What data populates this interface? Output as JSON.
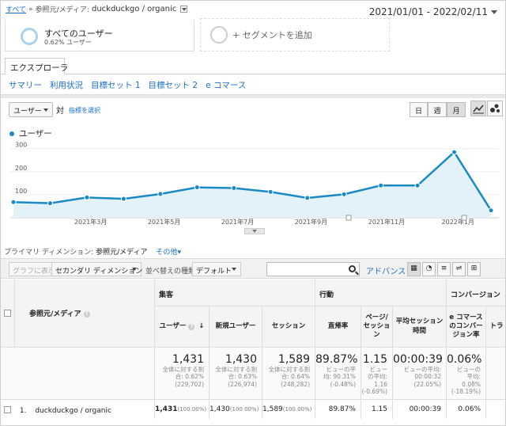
{
  "breadcrumb": {
    "root": "すべて",
    "sep": "»",
    "dim": "参照元/メディア:",
    "current": "duckduckgo / organic"
  },
  "date_range": "2021/01/01 - 2022/02/11",
  "segments": {
    "all_users": {
      "title": "すべてのユーザー",
      "sub": "0.62% ユーザー"
    },
    "add": "+ セグメントを追加"
  },
  "tab": "エクスプローラ",
  "subnav": [
    "サマリー",
    "利用状況",
    "目標セット 1",
    "目標セット 2",
    "e コマース"
  ],
  "metric_select": "ユーザー",
  "vs": "対",
  "pick_metric": "指標を選択",
  "granularity": [
    "日",
    "週",
    "月"
  ],
  "granularity_selected": "月",
  "chart_data": {
    "type": "area",
    "legend": "ユーザー",
    "y_ticks": [
      "100",
      "200",
      "300"
    ],
    "x_tick_labels": [
      "2021年3月",
      "2021年5月",
      "2021年7月",
      "2021年9月",
      "2021年11月",
      "2022年1月"
    ],
    "x": [
      "2021-01",
      "2021-02",
      "2021-03",
      "2021-04",
      "2021-05",
      "2021-06",
      "2021-07",
      "2021-08",
      "2021-09",
      "2021-10",
      "2021-11",
      "2021-12",
      "2022-01",
      "2022-02"
    ],
    "values": [
      68,
      63,
      88,
      82,
      103,
      132,
      129,
      112,
      86,
      102,
      140,
      140,
      285,
      32
    ],
    "ylim": [
      0,
      330
    ],
    "color": "#1a8ac6"
  },
  "dimension_row": {
    "label": "プライマリ ディメンション:",
    "current": "参照元/メディア",
    "other": "その他"
  },
  "toolbar": {
    "plot": "グラフに表示",
    "secondary": "セカンダリ ディメンション",
    "sort_label": "並べ替えの種類:",
    "sort": "デフォルト",
    "advanced": "アドバンス"
  },
  "table": {
    "dim_header": "参照元/メディア",
    "groups": [
      "集客",
      "行動",
      "コンバージョン"
    ],
    "columns": [
      "ユーザー",
      "新規ユーザー",
      "セッション",
      "直帰率",
      "ページ/セッション",
      "平均セッション時間",
      "e コマースのコンバージョン率",
      "トラ"
    ],
    "totals": [
      {
        "big": "1,431",
        "lines": [
          "全体に対する割",
          "合: 0.62%",
          "(229,702)"
        ]
      },
      {
        "big": "1,430",
        "lines": [
          "全体に対する割",
          "合: 0.63%",
          "(226,974)"
        ]
      },
      {
        "big": "1,589",
        "lines": [
          "全体に対する割",
          "合: 0.64%",
          "(248,282)"
        ]
      },
      {
        "big": "89.87%",
        "lines": [
          "ビューの平",
          "均: 90.31%",
          "(-0.48%)"
        ]
      },
      {
        "big": "1.15",
        "lines": [
          "ビュー",
          "の平均:",
          "1.16",
          "(-0.69%)"
        ]
      },
      {
        "big": "00:00:39",
        "lines": [
          "ビューの平均:",
          "00:00:32",
          "(22.05%)"
        ]
      },
      {
        "big": "0.06%",
        "lines": [
          "ビューの",
          "平均:",
          "0.08%",
          "(-18.19%)"
        ]
      }
    ],
    "rows": [
      {
        "index": "1.",
        "dim": "duckduckgo / organic",
        "users": "1,431",
        "users_pct": "(100.00%)",
        "new_users": "1,430",
        "new_users_pct": "(100.00%)",
        "sessions": "1,589",
        "sessions_pct": "(100.00%)",
        "bounce": "89.87%",
        "pps": "1.15",
        "duration": "00:00:39",
        "conv": "0.06%"
      }
    ]
  }
}
